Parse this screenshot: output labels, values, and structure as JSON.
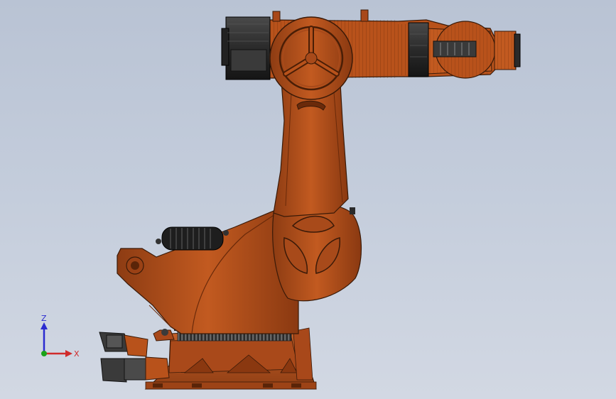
{
  "view": {
    "background_top": "#b9c3d4",
    "background_bottom": "#d2d8e3"
  },
  "robot": {
    "body_color": "#b8521b",
    "body_dark": "#7a3310",
    "body_light": "#cf6a2c",
    "motor_color": "#2b2b2b",
    "outline_color": "#3a1a08"
  },
  "triad": {
    "z_label": "Z",
    "x_label": "X",
    "z_color": "#2b2bd0",
    "x_color": "#d02b2b",
    "y_color": "#1aa31a"
  }
}
